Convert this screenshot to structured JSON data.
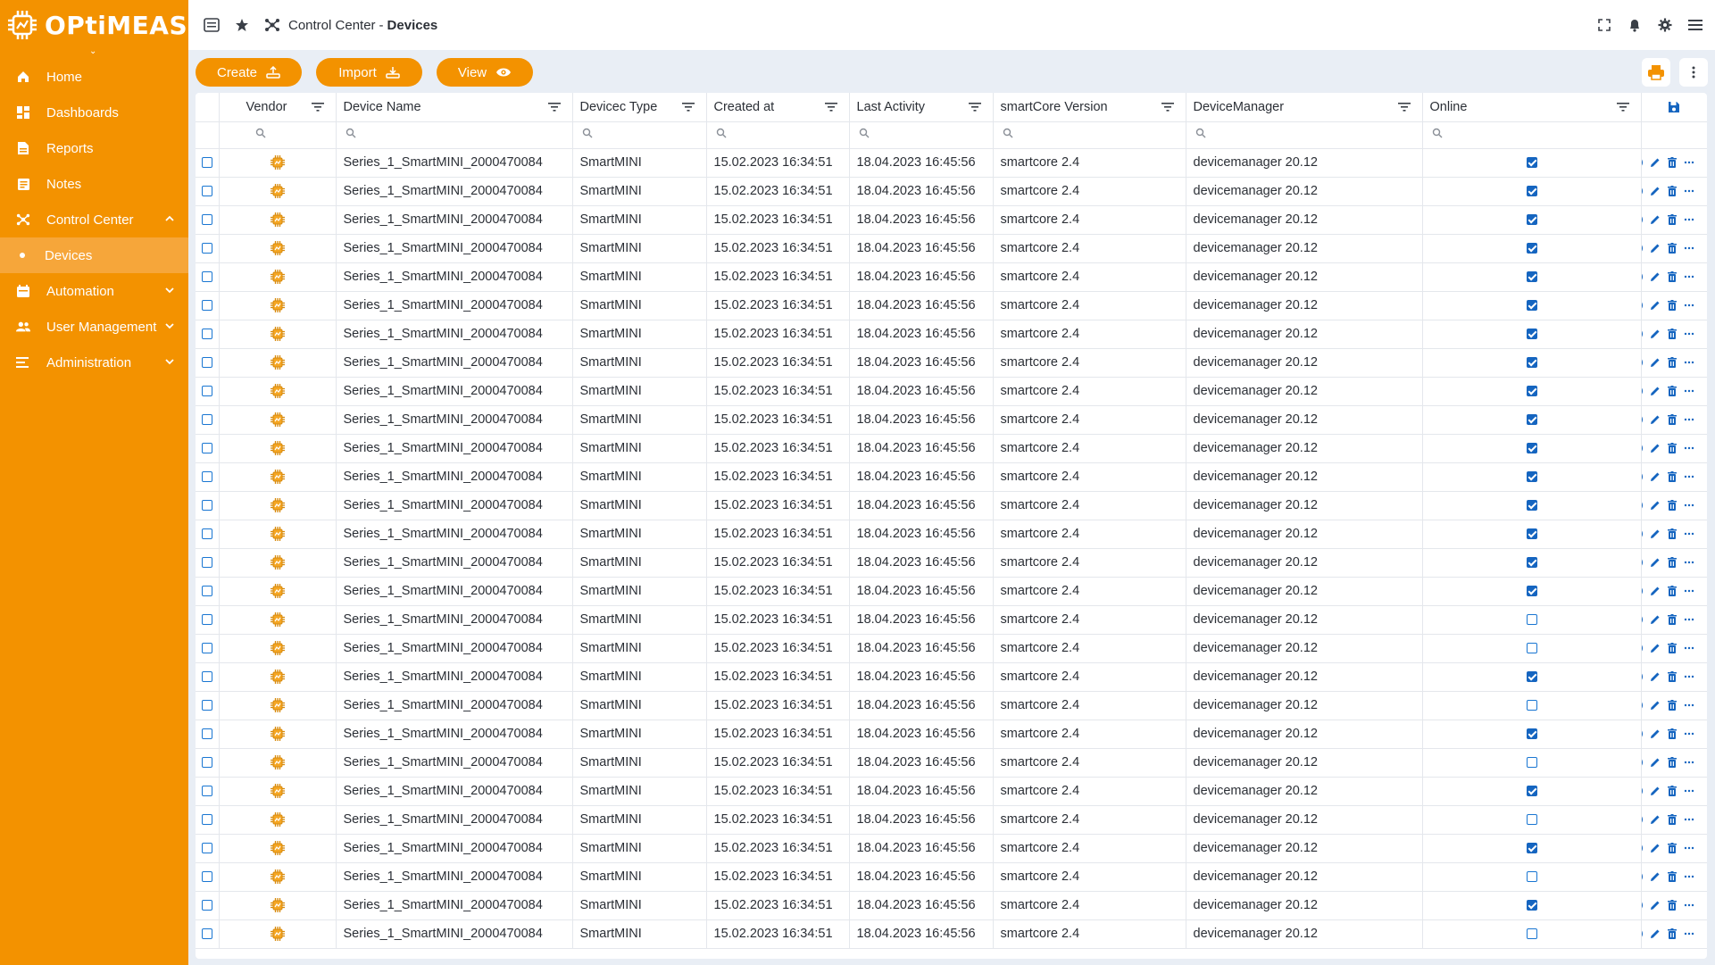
{
  "app": {
    "logo_text": "OPtiMEAS"
  },
  "sidebar": {
    "items": [
      {
        "label": "Home",
        "icon": "home-icon"
      },
      {
        "label": "Dashboards",
        "icon": "dashboard-icon"
      },
      {
        "label": "Reports",
        "icon": "report-icon"
      },
      {
        "label": "Notes",
        "icon": "notes-icon"
      },
      {
        "label": "Control Center",
        "icon": "control-center-icon",
        "expanded": true
      },
      {
        "label": "Devices",
        "sub": true,
        "active": true
      },
      {
        "label": "Automation",
        "icon": "automation-icon"
      },
      {
        "label": "User Management",
        "icon": "users-icon"
      },
      {
        "label": "Administration",
        "icon": "administration-icon"
      }
    ]
  },
  "header": {
    "breadcrumb_parent": "Control Center",
    "breadcrumb_sep": "-",
    "breadcrumb_current": "Devices"
  },
  "toolbar": {
    "create_label": "Create",
    "import_label": "Import",
    "view_label": "View"
  },
  "table": {
    "columns": [
      "Vendor",
      "Device Name",
      "Devicec Type",
      "Created at",
      "Last Activity",
      "smartCore Version",
      "DeviceManager",
      "Online"
    ],
    "rows": [
      {
        "name": "Series_1_SmartMINI_2000470084",
        "type": "SmartMINI",
        "created": "15.02.2023 16:34:51",
        "activity": "18.04.2023 16:45:56",
        "core": "smartcore 2.4",
        "manager": "devicemanager 20.12",
        "online": true
      },
      {
        "name": "Series_1_SmartMINI_2000470084",
        "type": "SmartMINI",
        "created": "15.02.2023 16:34:51",
        "activity": "18.04.2023 16:45:56",
        "core": "smartcore 2.4",
        "manager": "devicemanager 20.12",
        "online": true
      },
      {
        "name": "Series_1_SmartMINI_2000470084",
        "type": "SmartMINI",
        "created": "15.02.2023 16:34:51",
        "activity": "18.04.2023 16:45:56",
        "core": "smartcore 2.4",
        "manager": "devicemanager 20.12",
        "online": true
      },
      {
        "name": "Series_1_SmartMINI_2000470084",
        "type": "SmartMINI",
        "created": "15.02.2023 16:34:51",
        "activity": "18.04.2023 16:45:56",
        "core": "smartcore 2.4",
        "manager": "devicemanager 20.12",
        "online": true
      },
      {
        "name": "Series_1_SmartMINI_2000470084",
        "type": "SmartMINI",
        "created": "15.02.2023 16:34:51",
        "activity": "18.04.2023 16:45:56",
        "core": "smartcore 2.4",
        "manager": "devicemanager 20.12",
        "online": true
      },
      {
        "name": "Series_1_SmartMINI_2000470084",
        "type": "SmartMINI",
        "created": "15.02.2023 16:34:51",
        "activity": "18.04.2023 16:45:56",
        "core": "smartcore 2.4",
        "manager": "devicemanager 20.12",
        "online": true
      },
      {
        "name": "Series_1_SmartMINI_2000470084",
        "type": "SmartMINI",
        "created": "15.02.2023 16:34:51",
        "activity": "18.04.2023 16:45:56",
        "core": "smartcore 2.4",
        "manager": "devicemanager 20.12",
        "online": true
      },
      {
        "name": "Series_1_SmartMINI_2000470084",
        "type": "SmartMINI",
        "created": "15.02.2023 16:34:51",
        "activity": "18.04.2023 16:45:56",
        "core": "smartcore 2.4",
        "manager": "devicemanager 20.12",
        "online": true
      },
      {
        "name": "Series_1_SmartMINI_2000470084",
        "type": "SmartMINI",
        "created": "15.02.2023 16:34:51",
        "activity": "18.04.2023 16:45:56",
        "core": "smartcore 2.4",
        "manager": "devicemanager 20.12",
        "online": true
      },
      {
        "name": "Series_1_SmartMINI_2000470084",
        "type": "SmartMINI",
        "created": "15.02.2023 16:34:51",
        "activity": "18.04.2023 16:45:56",
        "core": "smartcore 2.4",
        "manager": "devicemanager 20.12",
        "online": true
      },
      {
        "name": "Series_1_SmartMINI_2000470084",
        "type": "SmartMINI",
        "created": "15.02.2023 16:34:51",
        "activity": "18.04.2023 16:45:56",
        "core": "smartcore 2.4",
        "manager": "devicemanager 20.12",
        "online": true
      },
      {
        "name": "Series_1_SmartMINI_2000470084",
        "type": "SmartMINI",
        "created": "15.02.2023 16:34:51",
        "activity": "18.04.2023 16:45:56",
        "core": "smartcore 2.4",
        "manager": "devicemanager 20.12",
        "online": true
      },
      {
        "name": "Series_1_SmartMINI_2000470084",
        "type": "SmartMINI",
        "created": "15.02.2023 16:34:51",
        "activity": "18.04.2023 16:45:56",
        "core": "smartcore 2.4",
        "manager": "devicemanager 20.12",
        "online": true
      },
      {
        "name": "Series_1_SmartMINI_2000470084",
        "type": "SmartMINI",
        "created": "15.02.2023 16:34:51",
        "activity": "18.04.2023 16:45:56",
        "core": "smartcore 2.4",
        "manager": "devicemanager 20.12",
        "online": true
      },
      {
        "name": "Series_1_SmartMINI_2000470084",
        "type": "SmartMINI",
        "created": "15.02.2023 16:34:51",
        "activity": "18.04.2023 16:45:56",
        "core": "smartcore 2.4",
        "manager": "devicemanager 20.12",
        "online": true
      },
      {
        "name": "Series_1_SmartMINI_2000470084",
        "type": "SmartMINI",
        "created": "15.02.2023 16:34:51",
        "activity": "18.04.2023 16:45:56",
        "core": "smartcore 2.4",
        "manager": "devicemanager 20.12",
        "online": true
      },
      {
        "name": "Series_1_SmartMINI_2000470084",
        "type": "SmartMINI",
        "created": "15.02.2023 16:34:51",
        "activity": "18.04.2023 16:45:56",
        "core": "smartcore 2.4",
        "manager": "devicemanager 20.12",
        "online": false
      },
      {
        "name": "Series_1_SmartMINI_2000470084",
        "type": "SmartMINI",
        "created": "15.02.2023 16:34:51",
        "activity": "18.04.2023 16:45:56",
        "core": "smartcore 2.4",
        "manager": "devicemanager 20.12",
        "online": false
      },
      {
        "name": "Series_1_SmartMINI_2000470084",
        "type": "SmartMINI",
        "created": "15.02.2023 16:34:51",
        "activity": "18.04.2023 16:45:56",
        "core": "smartcore 2.4",
        "manager": "devicemanager 20.12",
        "online": true
      },
      {
        "name": "Series_1_SmartMINI_2000470084",
        "type": "SmartMINI",
        "created": "15.02.2023 16:34:51",
        "activity": "18.04.2023 16:45:56",
        "core": "smartcore 2.4",
        "manager": "devicemanager 20.12",
        "online": false
      },
      {
        "name": "Series_1_SmartMINI_2000470084",
        "type": "SmartMINI",
        "created": "15.02.2023 16:34:51",
        "activity": "18.04.2023 16:45:56",
        "core": "smartcore 2.4",
        "manager": "devicemanager 20.12",
        "online": true
      },
      {
        "name": "Series_1_SmartMINI_2000470084",
        "type": "SmartMINI",
        "created": "15.02.2023 16:34:51",
        "activity": "18.04.2023 16:45:56",
        "core": "smartcore 2.4",
        "manager": "devicemanager 20.12",
        "online": false
      },
      {
        "name": "Series_1_SmartMINI_2000470084",
        "type": "SmartMINI",
        "created": "15.02.2023 16:34:51",
        "activity": "18.04.2023 16:45:56",
        "core": "smartcore 2.4",
        "manager": "devicemanager 20.12",
        "online": true
      },
      {
        "name": "Series_1_SmartMINI_2000470084",
        "type": "SmartMINI",
        "created": "15.02.2023 16:34:51",
        "activity": "18.04.2023 16:45:56",
        "core": "smartcore 2.4",
        "manager": "devicemanager 20.12",
        "online": false
      },
      {
        "name": "Series_1_SmartMINI_2000470084",
        "type": "SmartMINI",
        "created": "15.02.2023 16:34:51",
        "activity": "18.04.2023 16:45:56",
        "core": "smartcore 2.4",
        "manager": "devicemanager 20.12",
        "online": true
      },
      {
        "name": "Series_1_SmartMINI_2000470084",
        "type": "SmartMINI",
        "created": "15.02.2023 16:34:51",
        "activity": "18.04.2023 16:45:56",
        "core": "smartcore 2.4",
        "manager": "devicemanager 20.12",
        "online": false
      },
      {
        "name": "Series_1_SmartMINI_2000470084",
        "type": "SmartMINI",
        "created": "15.02.2023 16:34:51",
        "activity": "18.04.2023 16:45:56",
        "core": "smartcore 2.4",
        "manager": "devicemanager 20.12",
        "online": true
      },
      {
        "name": "Series_1_SmartMINI_2000470084",
        "type": "SmartMINI",
        "created": "15.02.2023 16:34:51",
        "activity": "18.04.2023 16:45:56",
        "core": "smartcore 2.4",
        "manager": "devicemanager 20.12",
        "online": false
      }
    ]
  },
  "colors": {
    "brand": "#f39200",
    "accent": "#1565c0",
    "vendor_chip": "#f5a623"
  }
}
